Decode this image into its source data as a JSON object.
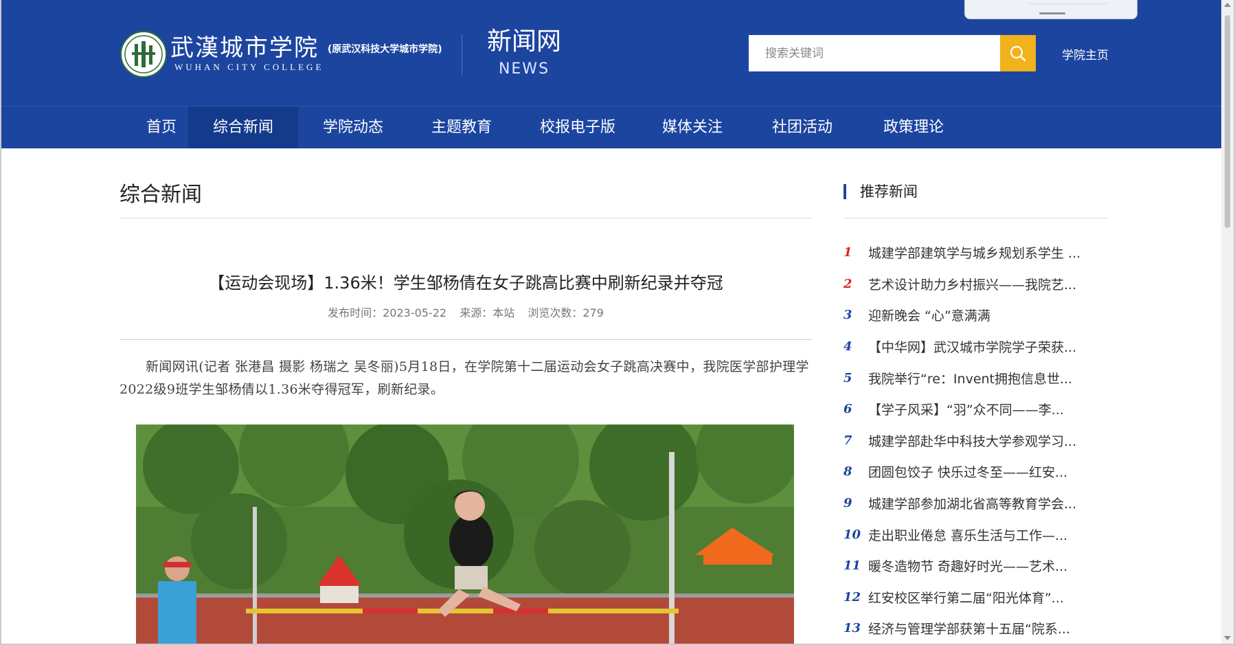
{
  "header": {
    "school_name_cn": "武漢城市学院",
    "school_former_name": "(原武汉科技大学城市学院)",
    "school_name_en": "WUHAN CITY COLLEGE",
    "site_title": "新闻网",
    "site_title_en": "NEWS",
    "search_placeholder": "搜索关键词",
    "home_link": "学院主页",
    "colors": {
      "primary": "#1c45a0",
      "accent": "#f2b21c"
    }
  },
  "nav": {
    "items": [
      {
        "label": "首页",
        "active": false
      },
      {
        "label": "综合新闻",
        "active": true
      },
      {
        "label": "学院动态",
        "active": false
      },
      {
        "label": "主题教育",
        "active": false
      },
      {
        "label": "校报电子版",
        "active": false
      },
      {
        "label": "媒体关注",
        "active": false
      },
      {
        "label": "社团活动",
        "active": false
      },
      {
        "label": "政策理论",
        "active": false
      }
    ]
  },
  "main": {
    "section_title": "综合新闻",
    "article": {
      "title": "【运动会现场】1.36米！学生邹杨倩在女子跳高比赛中刷新纪录并夺冠",
      "published": "发布时间：2023-05-22",
      "source": "来源：本站",
      "views": "浏览次数：279",
      "body": "新闻网讯(记者 张港昌 摄影 杨瑞之 吴冬丽)5月18日，在学院第十二届运动会女子跳高决赛中，我院医学部护理学2022级9班学生邹杨倩以1.36米夺得冠军，刷新纪录。"
    }
  },
  "sidebar": {
    "title": "推荐新闻",
    "items": [
      {
        "num": "1",
        "text": "城建学部建筑学与城乡规划系学生 ..."
      },
      {
        "num": "2",
        "text": "艺术设计助力乡村振兴——我院艺..."
      },
      {
        "num": "3",
        "text": "迎新晚会 “心”意满满"
      },
      {
        "num": "4",
        "text": "【中华网】武汉城市学院学子荣获..."
      },
      {
        "num": "5",
        "text": "我院举行“re：Invent拥抱信息世..."
      },
      {
        "num": "6",
        "text": "【学子风采】“羽”众不同——李..."
      },
      {
        "num": "7",
        "text": "城建学部赴华中科技大学参观学习..."
      },
      {
        "num": "8",
        "text": "团圆包饺子 快乐过冬至——红安..."
      },
      {
        "num": "9",
        "text": "城建学部参加湖北省高等教育学会..."
      },
      {
        "num": "10",
        "text": "走出职业倦怠 喜乐生活与工作—..."
      },
      {
        "num": "11",
        "text": "暖冬造物节 奇趣好时光——艺术..."
      },
      {
        "num": "12",
        "text": "红安校区举行第二届“阳光体育”..."
      },
      {
        "num": "13",
        "text": "经济与管理学部获第十五届“院系..."
      }
    ]
  }
}
